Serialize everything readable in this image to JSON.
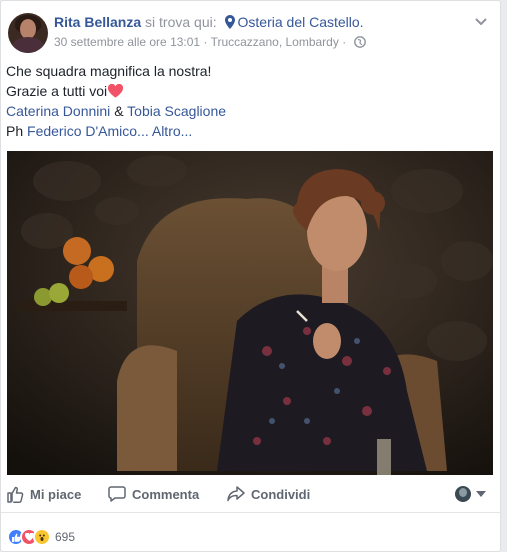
{
  "post": {
    "author": "Rita Bellanza",
    "verb": "si trova qui:",
    "place": "Osteria del Castello.",
    "date": "30 settembre alle ore 13:01",
    "location": "Truccazzano, Lombardy",
    "separator": "·",
    "text_line1": "Che squadra magnifica la nostra!",
    "text_line2": "Grazie a tutti voi",
    "tag1": "Caterina Donnini",
    "amp": "&",
    "tag2": "Tobia Scaglione",
    "ph_label": "Ph",
    "photographer": "Federico D'Amico...",
    "more": "Altro..."
  },
  "actions": {
    "like": "Mi piace",
    "comment": "Commenta",
    "share": "Condividi"
  },
  "reactions": {
    "count": "695",
    "types": [
      "like",
      "love",
      "wow"
    ]
  },
  "colors": {
    "link": "#365899",
    "meta": "#90949c",
    "like_blue": "#4080ff",
    "love_red": "#f25268",
    "wow_yellow": "#f7c630"
  }
}
